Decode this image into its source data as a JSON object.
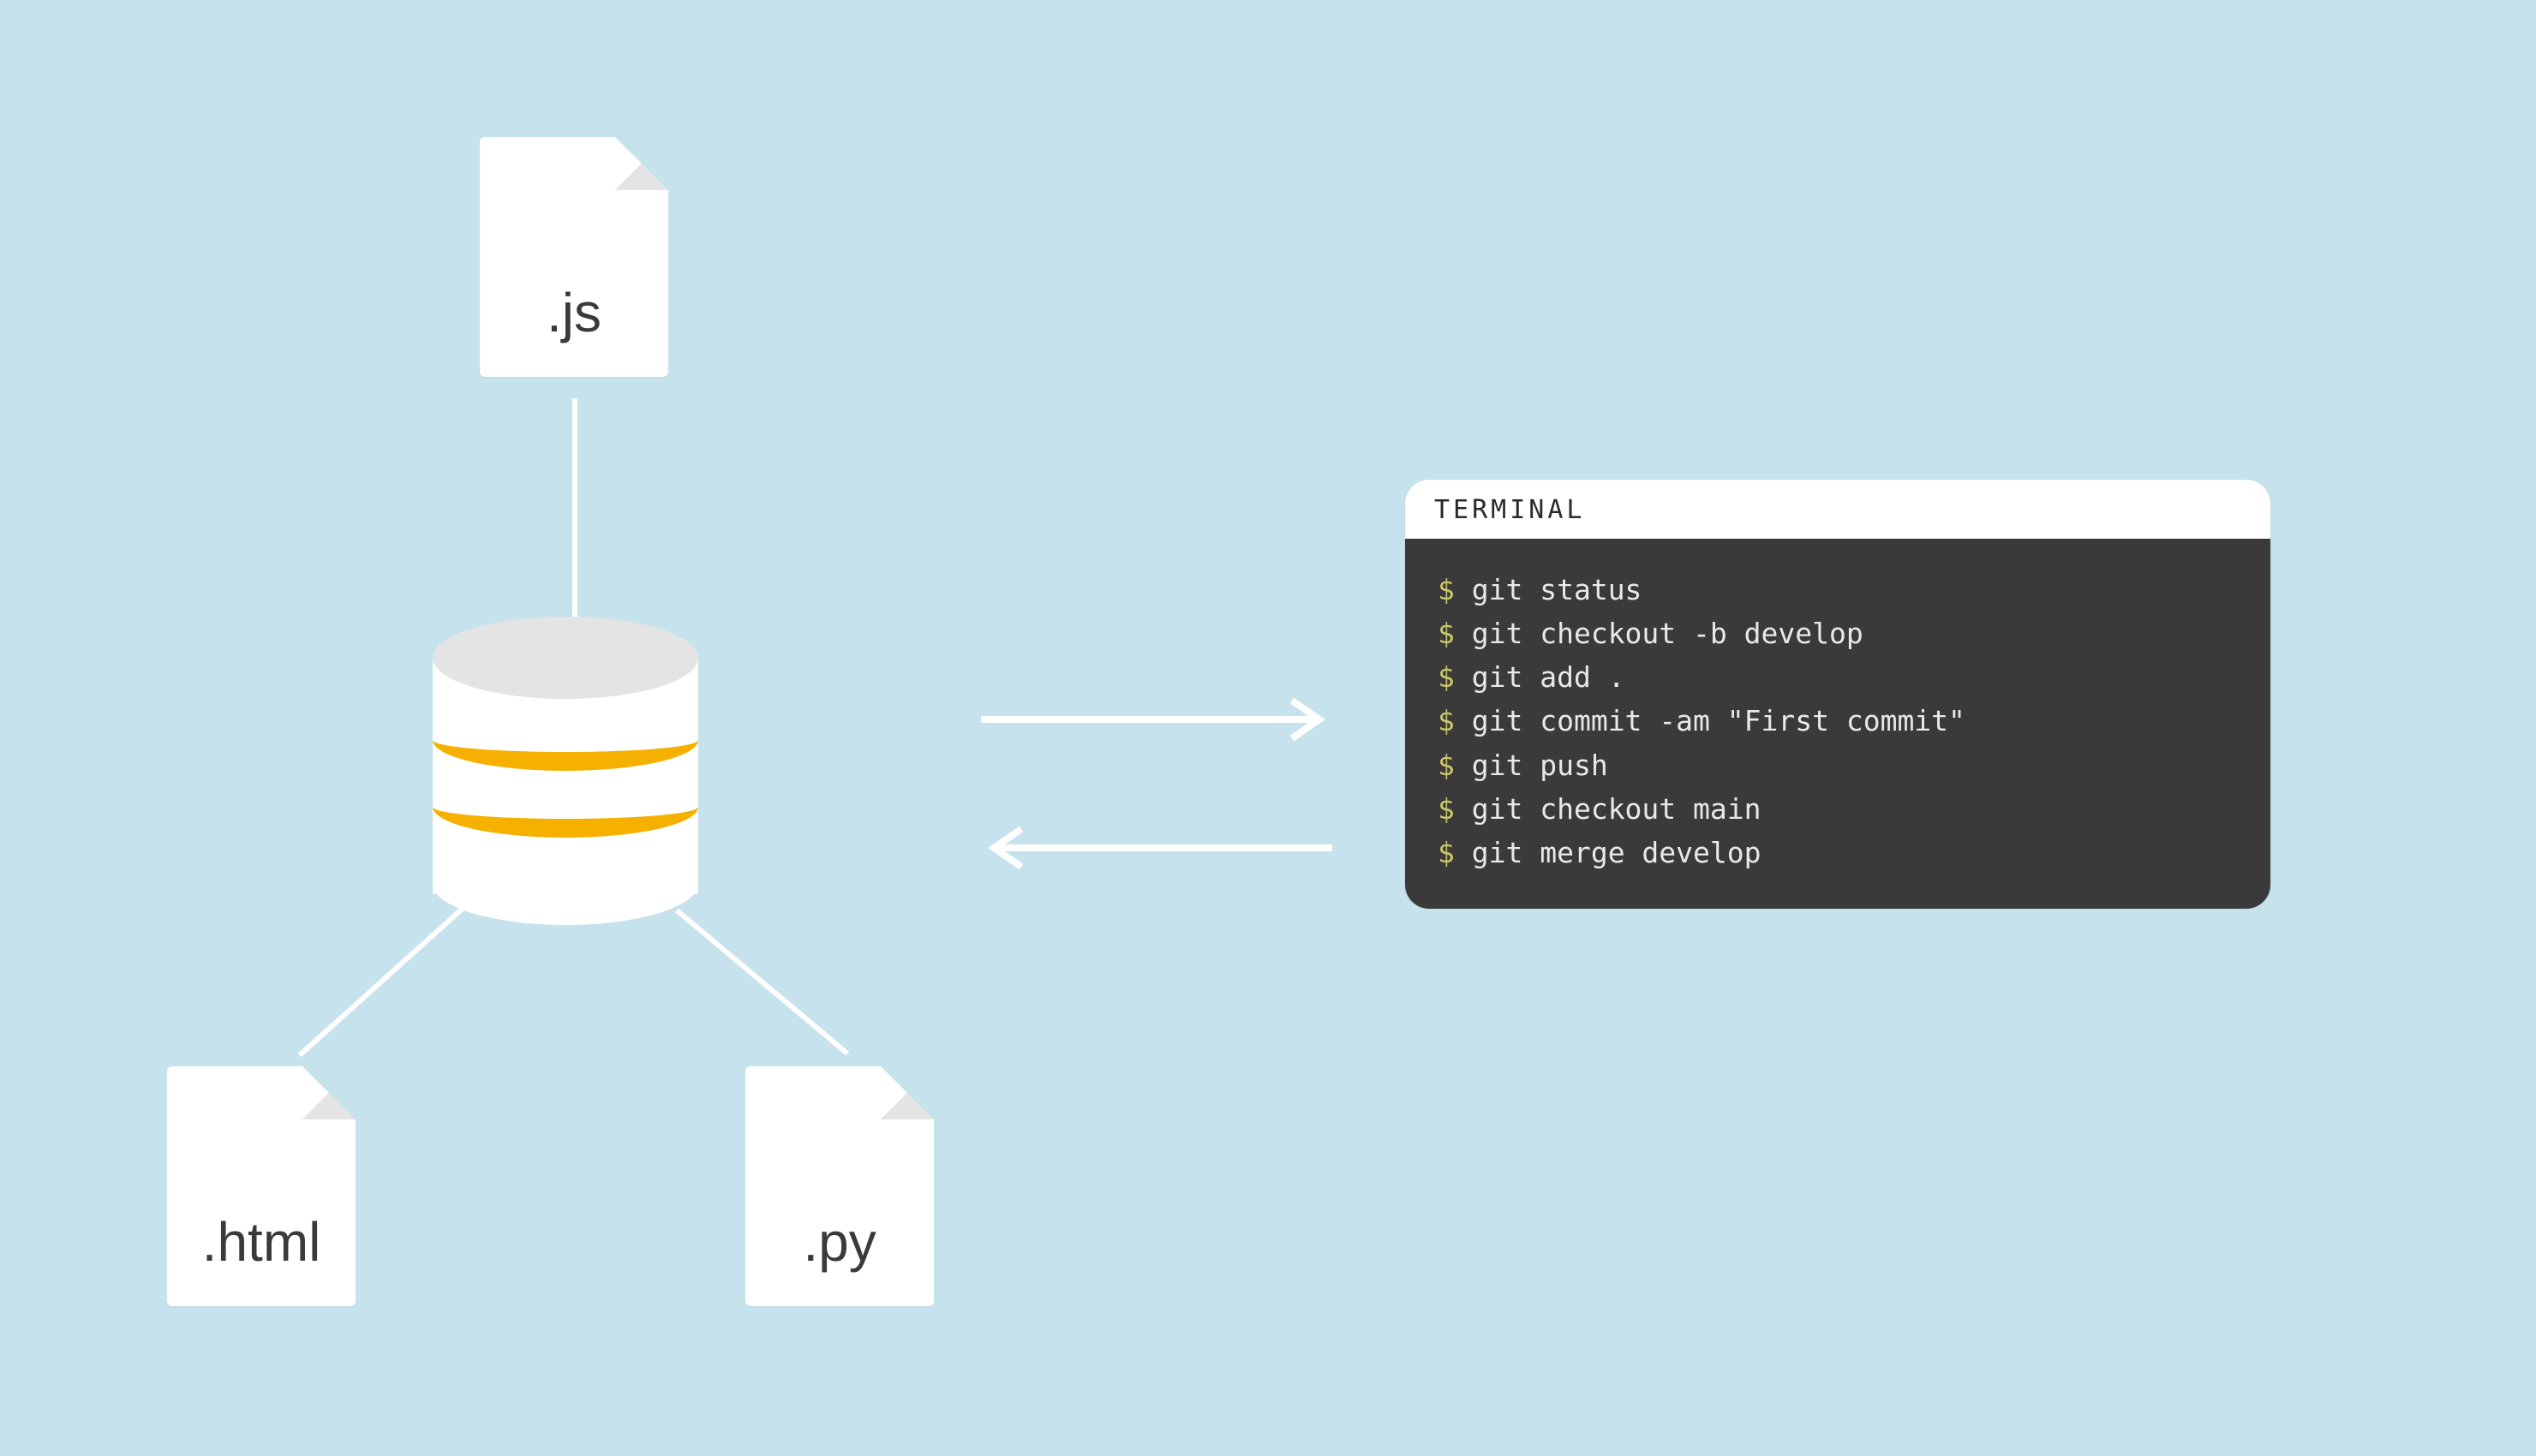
{
  "files": {
    "js": {
      "ext": ".js"
    },
    "html": {
      "ext": ".html"
    },
    "py": {
      "ext": ".py"
    }
  },
  "terminal": {
    "title": "TERMINAL",
    "prompt": "$",
    "commands": [
      "git status",
      "git checkout -b develop",
      "git add .",
      "git commit -am \"First commit\"",
      "git push",
      "git checkout main",
      "git merge develop"
    ]
  }
}
